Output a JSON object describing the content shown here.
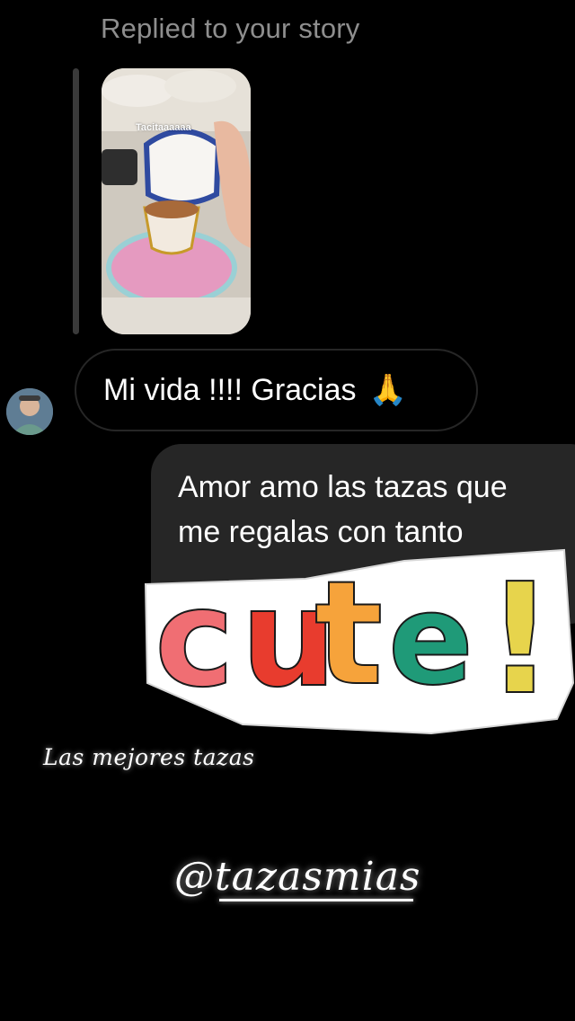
{
  "reply_header": {
    "label": "Replied to your story"
  },
  "story": {
    "caption": "Tacitaaaaaa"
  },
  "messages": {
    "incoming": {
      "text": "Mi vida !!!! Gracias",
      "emoji": "🙏"
    },
    "outgoing": {
      "line1": "Amor amo las tazas que",
      "line2": "me regalas con tanto"
    }
  },
  "sticker": {
    "letters": [
      "C",
      "U",
      "T",
      "E",
      "!"
    ],
    "colors": [
      "#f06e73",
      "#e83c2e",
      "#f6a33b",
      "#1f9a78",
      "#e7d44c"
    ]
  },
  "overlay": {
    "caption": "Las mejores tazas",
    "handle": "@tazasmias"
  },
  "colors": {
    "background": "#000000",
    "bubble": "#262626",
    "muted_text": "#8e8e8e"
  }
}
